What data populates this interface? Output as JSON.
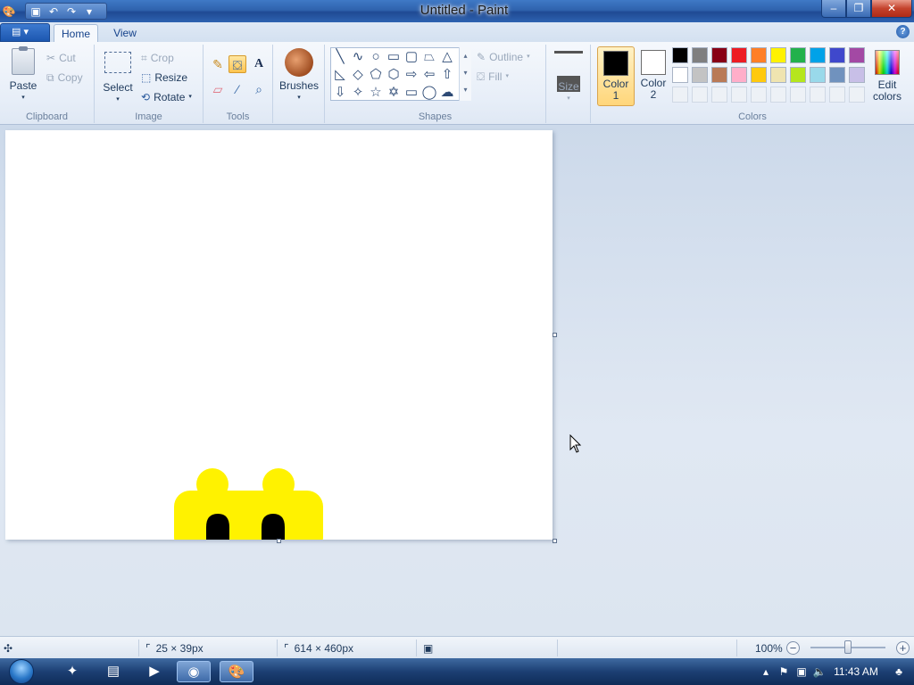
{
  "window": {
    "title": "Untitled - Paint"
  },
  "tabs": {
    "home": "Home",
    "view": "View"
  },
  "clipboard": {
    "paste": "Paste",
    "cut": "Cut",
    "copy": "Copy",
    "group": "Clipboard"
  },
  "image": {
    "select": "Select",
    "crop": "Crop",
    "resize": "Resize",
    "rotate": "Rotate",
    "group": "Image"
  },
  "tools": {
    "group": "Tools",
    "active_tool": "fill-bucket"
  },
  "brushes": {
    "label": "Brushes"
  },
  "shapes": {
    "group": "Shapes",
    "outline": "Outline",
    "fill": "Fill"
  },
  "size": {
    "label": "Size"
  },
  "colors": {
    "group": "Colors",
    "color1_label": "Color",
    "color1_num": "1",
    "color2_label": "Color",
    "color2_num": "2",
    "color1_value": "#000000",
    "color2_value": "#ffffff",
    "edit_label": "Edit",
    "edit_label2": "colors",
    "palette_row1": [
      "#000000",
      "#7f7f7f",
      "#880015",
      "#ed1c24",
      "#ff7f27",
      "#fff200",
      "#22b14c",
      "#00a2e8",
      "#3f48cc",
      "#a349a4"
    ],
    "palette_row2": [
      "#ffffff",
      "#c3c3c3",
      "#b97a57",
      "#ffaec9",
      "#ffc90e",
      "#efe4b0",
      "#b5e61d",
      "#99d9ea",
      "#7092be",
      "#c8bfe7"
    ]
  },
  "drawing": {
    "fill_color": "#fff200",
    "eye_color": "#000000"
  },
  "status": {
    "selection_size": "25 × 39px",
    "image_size": "614 × 460px",
    "zoom": "100%"
  },
  "taskbar": {
    "clock": "11:43 AM"
  }
}
